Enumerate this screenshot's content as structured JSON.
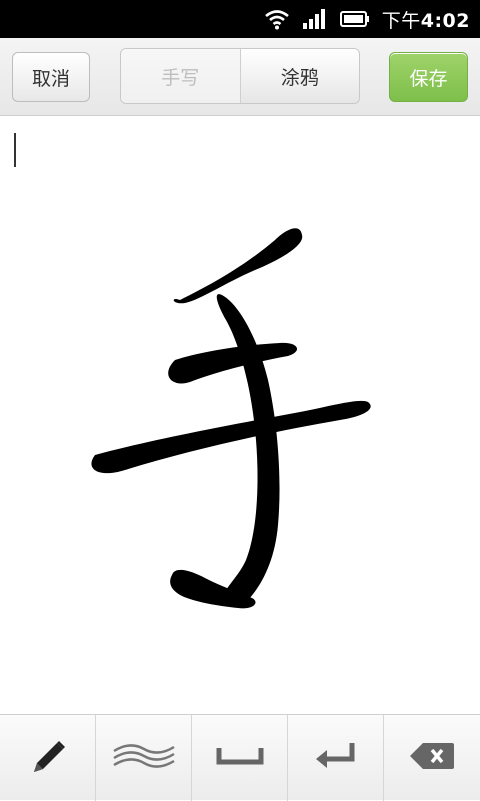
{
  "status_bar": {
    "clock_prefix": "下午",
    "clock_time": "4:02",
    "icons": [
      "wifi-icon",
      "signal-icon",
      "battery-icon"
    ]
  },
  "header": {
    "cancel_label": "取消",
    "save_label": "保存",
    "tabs": [
      {
        "label": "手写",
        "active": true
      },
      {
        "label": "涂鸦",
        "active": false
      }
    ],
    "save_color": "#8cc85a"
  },
  "canvas": {
    "drawn_character": "手"
  },
  "toolbar": {
    "tools": [
      "pen-icon",
      "brush-stroke-icon",
      "space-icon",
      "enter-icon",
      "backspace-icon"
    ]
  }
}
